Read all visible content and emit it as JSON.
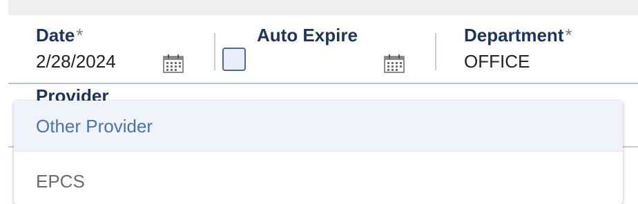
{
  "form": {
    "date": {
      "label": "Date",
      "required_mark": "*",
      "value": "2/28/2024",
      "icon": "calendar-icon"
    },
    "auto_expire": {
      "label": "Auto Expire",
      "checked": false,
      "icon": "calendar-icon"
    },
    "department": {
      "label": "Department",
      "required_mark": "*",
      "value": "OFFICE"
    },
    "provider": {
      "label": "Provider"
    }
  },
  "dropdown": {
    "options": [
      {
        "label": "Other Provider",
        "highlighted": true
      },
      {
        "label": "EPCS",
        "highlighted": false
      }
    ]
  },
  "colors": {
    "label": "#1b355e",
    "highlight_bg": "#eef3fc",
    "highlight_text": "#4a73ad",
    "checkbox_border": "#4a6994"
  }
}
